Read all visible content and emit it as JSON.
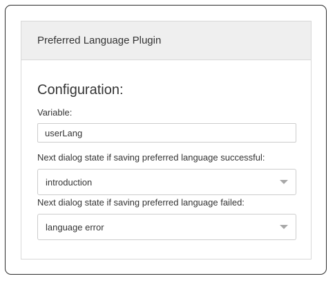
{
  "panel": {
    "title": "Preferred Language Plugin"
  },
  "config": {
    "heading": "Configuration:",
    "variable_label": "Variable:",
    "variable_value": "userLang",
    "success_label": "Next dialog state if saving preferred language successful:",
    "success_value": "introduction",
    "failed_label": "Next dialog state if saving preferred language failed:",
    "failed_value": "language error"
  },
  "icons": {
    "dropdown": "chevron-down-icon"
  }
}
